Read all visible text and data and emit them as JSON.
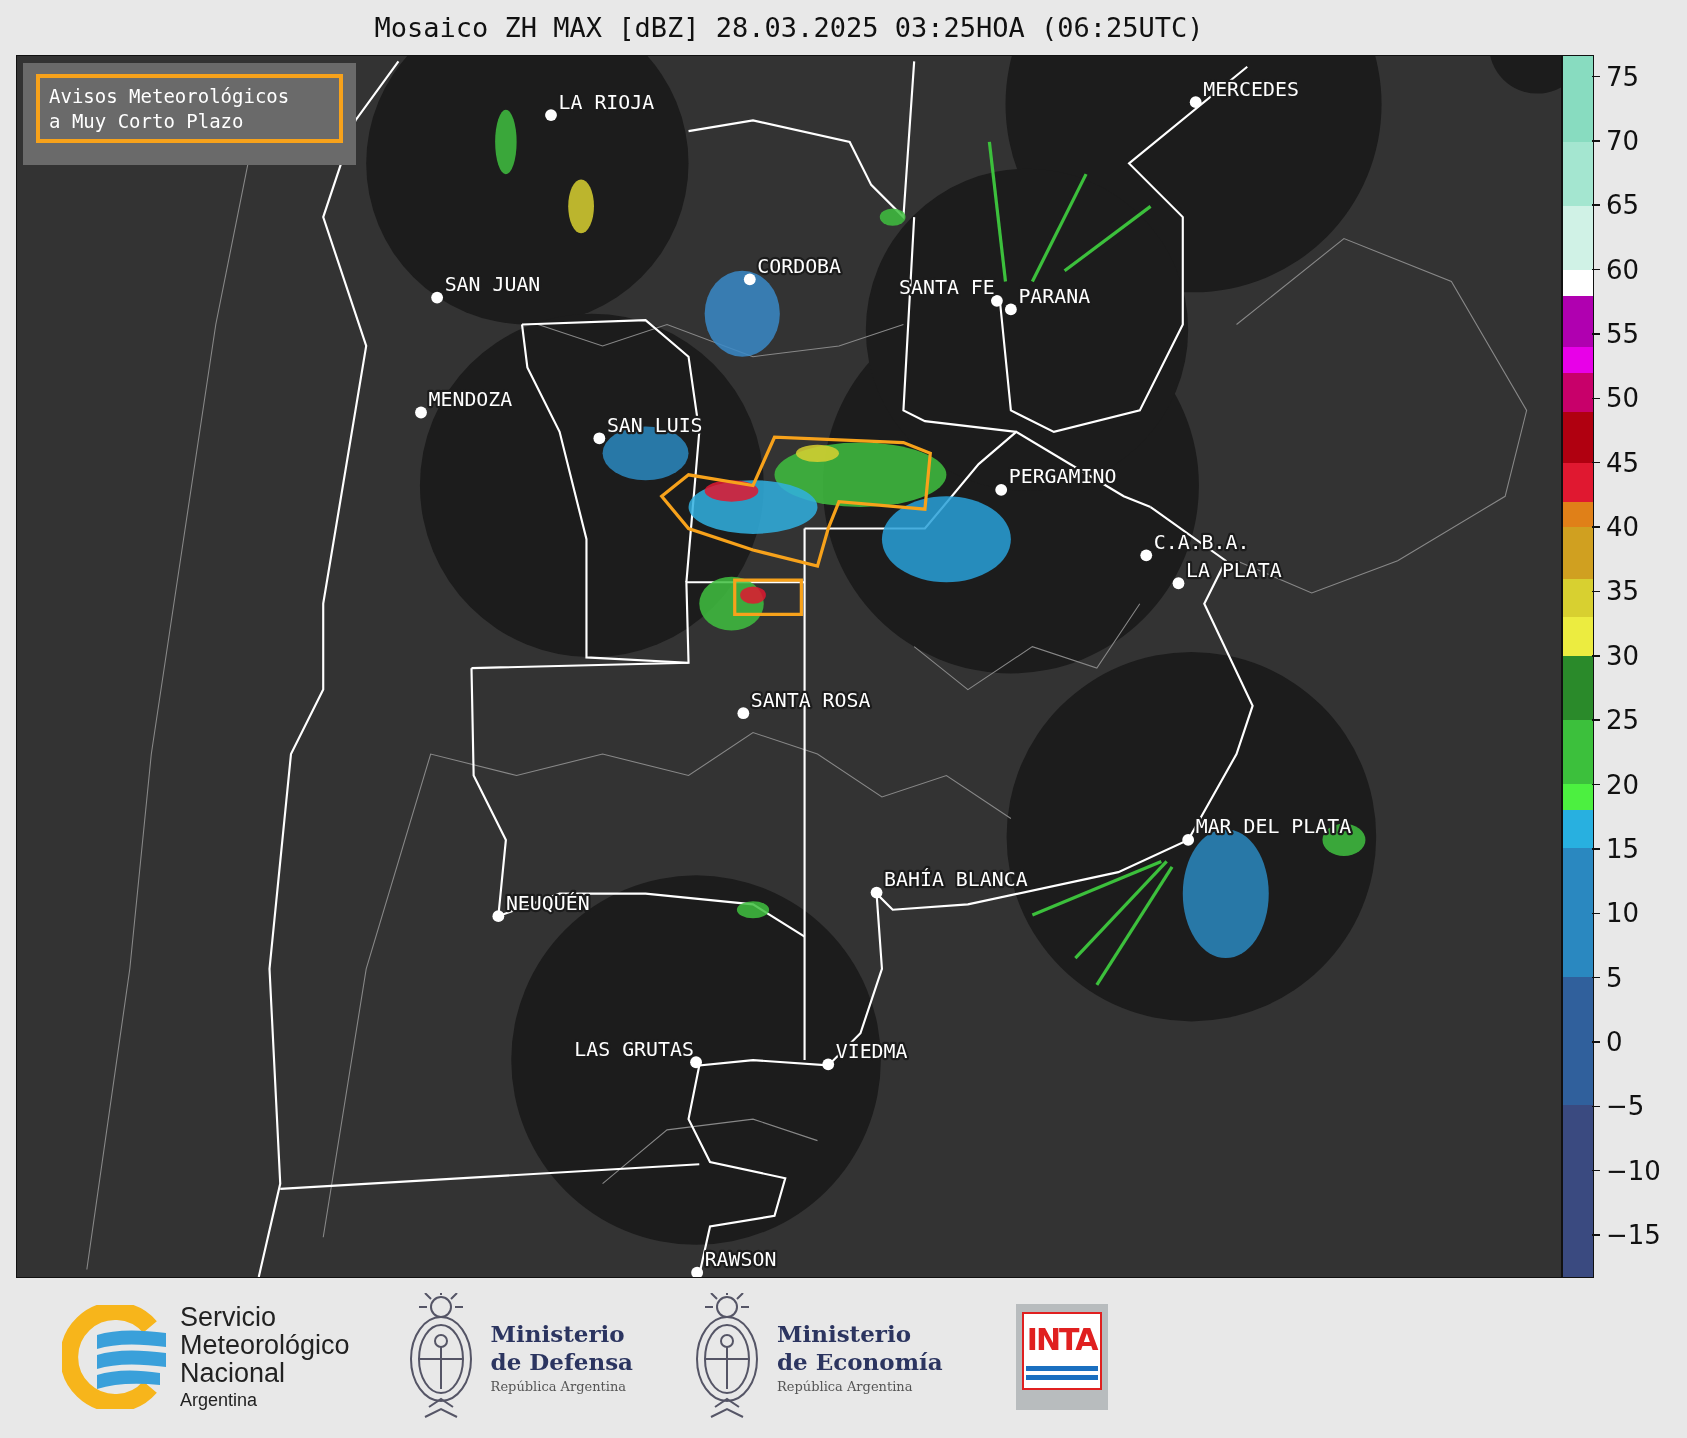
{
  "title": "Mosaico ZH MAX [dBZ] 28.03.2025 03:25HOA (06:25UTC)",
  "map": {
    "legend": "Avisos Meteorológicos\na Muy Corto Plazo",
    "cities": [
      "MERCEDES",
      "LA RIOJA",
      "CORDOBA",
      "SAN JUAN",
      "SANTA FE",
      "PARANA",
      "MENDOZA",
      "SAN LUIS",
      "PERGAMINO",
      "C.A.B.A.",
      "LA PLATA",
      "SANTA ROSA",
      "MAR DEL PLATA",
      "BAHÍA BLANCA",
      "NEUQUÉN",
      "LAS GRUTAS",
      "VIEDMA",
      "RAWSON"
    ]
  },
  "colorbar": {
    "ticks": [
      "75",
      "70",
      "65",
      "60",
      "55",
      "50",
      "45",
      "40",
      "35",
      "30",
      "25",
      "20",
      "15",
      "10",
      "5",
      "0",
      "−5",
      "−10",
      "−15"
    ]
  },
  "footer": {
    "logos": [
      {
        "kind": "smn",
        "lines": [
          "Servicio",
          "Meteorológico",
          "Nacional"
        ],
        "sub": "Argentina"
      },
      {
        "kind": "ministry",
        "name": "Ministerio",
        "unit": "de Defensa",
        "sub": "República Argentina"
      },
      {
        "kind": "ministry",
        "name": "Ministerio",
        "unit": "de Economía",
        "sub": "República Argentina"
      },
      {
        "kind": "inta",
        "text": "INTA"
      }
    ]
  }
}
